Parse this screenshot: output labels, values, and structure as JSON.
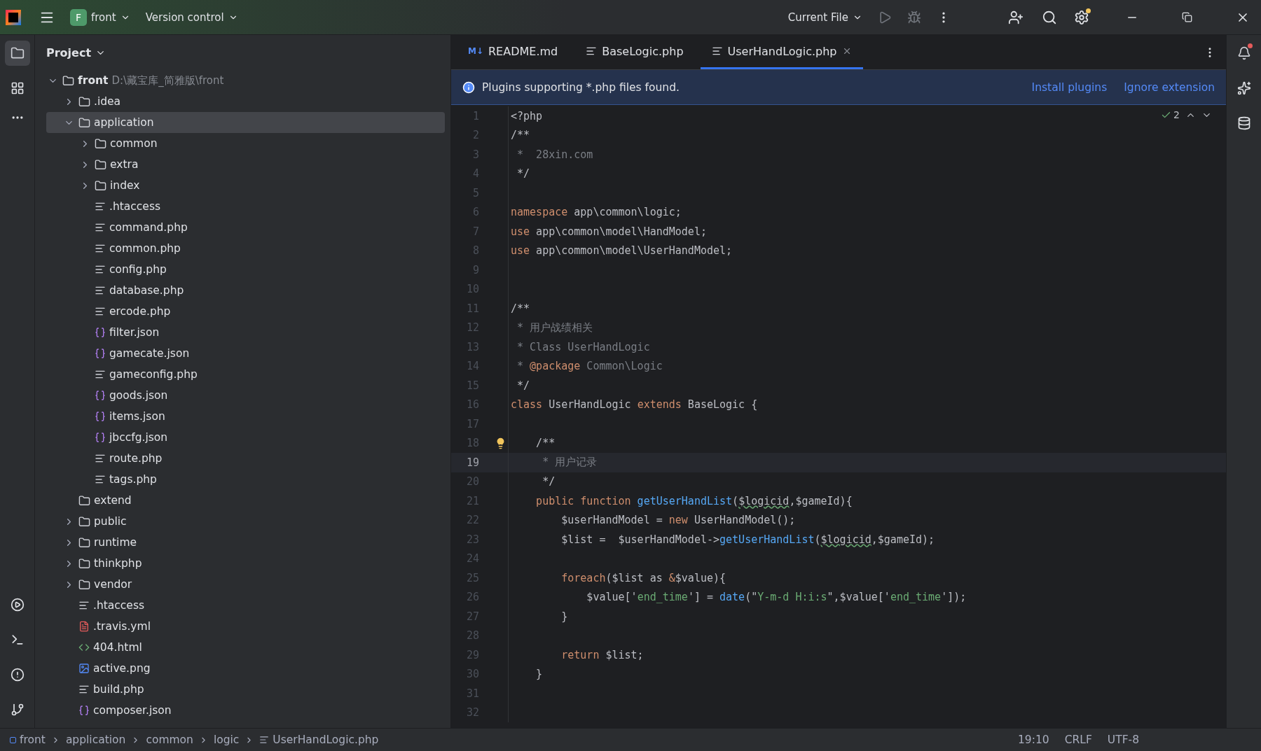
{
  "titlebar": {
    "project_badge": "F",
    "project": "front",
    "vcs": "Version control",
    "run_config": "Current File"
  },
  "project_panel": {
    "title": "Project",
    "tree": [
      {
        "name": "front",
        "path": "D:\\藏宝库_简雅版\\front",
        "kind": "root",
        "expanded": true,
        "selected": false,
        "children": [
          {
            "name": ".idea",
            "kind": "folder",
            "expanded": false,
            "selected": false
          },
          {
            "name": "application",
            "kind": "folder",
            "expanded": true,
            "selected": true,
            "children": [
              {
                "name": "common",
                "kind": "folder",
                "expanded": false,
                "selected": false
              },
              {
                "name": "extra",
                "kind": "folder",
                "expanded": false,
                "selected": false
              },
              {
                "name": "index",
                "kind": "folder",
                "expanded": false,
                "selected": false
              },
              {
                "name": ".htaccess",
                "kind": "text",
                "selected": false
              },
              {
                "name": "command.php",
                "kind": "text",
                "selected": false
              },
              {
                "name": "common.php",
                "kind": "text",
                "selected": false
              },
              {
                "name": "config.php",
                "kind": "text",
                "selected": false
              },
              {
                "name": "database.php",
                "kind": "text",
                "selected": false
              },
              {
                "name": "ercode.php",
                "kind": "text",
                "selected": false
              },
              {
                "name": "filter.json",
                "kind": "json",
                "selected": false
              },
              {
                "name": "gamecate.json",
                "kind": "json",
                "selected": false
              },
              {
                "name": "gameconfig.php",
                "kind": "text",
                "selected": false
              },
              {
                "name": "goods.json",
                "kind": "json",
                "selected": false
              },
              {
                "name": "items.json",
                "kind": "json",
                "selected": false
              },
              {
                "name": "jbccfg.json",
                "kind": "json",
                "selected": false
              },
              {
                "name": "route.php",
                "kind": "text",
                "selected": false
              },
              {
                "name": "tags.php",
                "kind": "text",
                "selected": false
              }
            ]
          },
          {
            "name": "extend",
            "kind": "folder",
            "selected": false
          },
          {
            "name": "public",
            "kind": "folder",
            "expanded": false,
            "selected": false
          },
          {
            "name": "runtime",
            "kind": "folder",
            "expanded": false,
            "selected": false
          },
          {
            "name": "thinkphp",
            "kind": "folder",
            "expanded": false,
            "selected": false
          },
          {
            "name": "vendor",
            "kind": "folder",
            "expanded": false,
            "selected": false
          },
          {
            "name": ".htaccess",
            "kind": "text",
            "selected": false
          },
          {
            "name": ".travis.yml",
            "kind": "yaml",
            "selected": false
          },
          {
            "name": "404.html",
            "kind": "html",
            "selected": false
          },
          {
            "name": "active.png",
            "kind": "image",
            "selected": false
          },
          {
            "name": "build.php",
            "kind": "text",
            "selected": false
          },
          {
            "name": "composer.json",
            "kind": "json",
            "selected": false
          }
        ]
      }
    ]
  },
  "editor": {
    "tabs": [
      {
        "label": "README.md",
        "kind": "markdown",
        "badge": "M↓",
        "selected": false
      },
      {
        "label": "BaseLogic.php",
        "kind": "text",
        "selected": false
      },
      {
        "label": "UserHandLogic.php",
        "kind": "text",
        "selected": true
      }
    ],
    "banner": {
      "message": "Plugins supporting *.php files found.",
      "actions": [
        "Install plugins",
        "Ignore extension"
      ]
    },
    "inspections": "2",
    "lines": [
      {
        "number": "1",
        "current": false,
        "bulb": false,
        "tokens": [
          {
            "kind": "plain",
            "text": "<?php"
          }
        ]
      },
      {
        "number": "2",
        "current": false,
        "bulb": false,
        "tokens": [
          {
            "kind": "plain",
            "text": "/**"
          }
        ]
      },
      {
        "number": "3",
        "current": false,
        "bulb": false,
        "tokens": [
          {
            "kind": "comment",
            "text": " *  28xin.com"
          }
        ]
      },
      {
        "number": "4",
        "current": false,
        "bulb": false,
        "tokens": [
          {
            "kind": "plain",
            "text": " */"
          }
        ]
      },
      {
        "number": "5",
        "current": false,
        "bulb": false
      },
      {
        "number": "6",
        "current": false,
        "bulb": false,
        "tokens": [
          {
            "kind": "keyword",
            "text": "namespace"
          },
          {
            "kind": "plain",
            "text": " app\\common\\logic;"
          }
        ]
      },
      {
        "number": "7",
        "current": false,
        "bulb": false,
        "tokens": [
          {
            "kind": "keyword",
            "text": "use"
          },
          {
            "kind": "plain",
            "text": " app\\common\\model\\HandModel;"
          }
        ]
      },
      {
        "number": "8",
        "current": false,
        "bulb": false,
        "tokens": [
          {
            "kind": "keyword",
            "text": "use"
          },
          {
            "kind": "plain",
            "text": " app\\common\\model\\UserHandModel;"
          }
        ]
      },
      {
        "number": "9",
        "current": false,
        "bulb": false
      },
      {
        "number": "10",
        "current": false,
        "bulb": false
      },
      {
        "number": "11",
        "current": false,
        "bulb": false,
        "tokens": [
          {
            "kind": "plain",
            "text": "/**"
          }
        ]
      },
      {
        "number": "12",
        "current": false,
        "bulb": false,
        "tokens": [
          {
            "kind": "comment",
            "text": " * 用户战绩相关"
          }
        ]
      },
      {
        "number": "13",
        "current": false,
        "bulb": false,
        "tokens": [
          {
            "kind": "comment",
            "text": " * Class UserHandLogic"
          }
        ]
      },
      {
        "number": "14",
        "current": false,
        "bulb": false,
        "tokens": [
          {
            "kind": "comment",
            "text": " *"
          },
          {
            "kind": "doctag",
            "text": " @package"
          },
          {
            "kind": "comment",
            "text": " Common\\Logic"
          }
        ]
      },
      {
        "number": "15",
        "current": false,
        "bulb": false,
        "tokens": [
          {
            "kind": "plain",
            "text": " */"
          }
        ]
      },
      {
        "number": "16",
        "current": false,
        "bulb": false,
        "tokens": [
          {
            "kind": "keyword",
            "text": "class"
          },
          {
            "kind": "plain",
            "text": " UserHandLogic "
          },
          {
            "kind": "keyword",
            "text": "extends"
          },
          {
            "kind": "plain",
            "text": " BaseLogic {"
          }
        ]
      },
      {
        "number": "17",
        "current": false,
        "bulb": false
      },
      {
        "number": "18",
        "current": false,
        "bulb": true,
        "tokens": [
          {
            "kind": "plain",
            "text": "    /**"
          }
        ]
      },
      {
        "number": "19",
        "current": true,
        "bulb": false,
        "tokens": [
          {
            "kind": "comment",
            "text": "     * 用户记录"
          }
        ]
      },
      {
        "number": "20",
        "current": false,
        "bulb": false,
        "tokens": [
          {
            "kind": "plain",
            "text": "     */"
          }
        ]
      },
      {
        "number": "21",
        "current": false,
        "bulb": false,
        "tokens": [
          {
            "kind": "keyword",
            "text": "    public function"
          },
          {
            "kind": "func",
            "text": " getUserHandList"
          },
          {
            "kind": "plain",
            "text": "("
          },
          {
            "kind": "warn",
            "text": "$logicid"
          },
          {
            "kind": "plain",
            "text": ",$gameId){"
          }
        ]
      },
      {
        "number": "22",
        "current": false,
        "bulb": false,
        "tokens": [
          {
            "kind": "plain",
            "text": "        $userHandModel = "
          },
          {
            "kind": "keyword",
            "text": "new"
          },
          {
            "kind": "plain",
            "text": " UserHandModel();"
          }
        ]
      },
      {
        "number": "23",
        "current": false,
        "bulb": false,
        "tokens": [
          {
            "kind": "plain",
            "text": "        $list =  $userHandModel->"
          },
          {
            "kind": "func",
            "text": "getUserHandList"
          },
          {
            "kind": "plain",
            "text": "("
          },
          {
            "kind": "warn",
            "text": "$logicid"
          },
          {
            "kind": "plain",
            "text": ",$gameId);"
          }
        ]
      },
      {
        "number": "24",
        "current": false,
        "bulb": false
      },
      {
        "number": "25",
        "current": false,
        "bulb": false,
        "tokens": [
          {
            "kind": "keyword",
            "text": "        foreach"
          },
          {
            "kind": "plain",
            "text": "($list as "
          },
          {
            "kind": "keyword",
            "text": "&"
          },
          {
            "kind": "plain",
            "text": "$value){"
          }
        ]
      },
      {
        "number": "26",
        "current": false,
        "bulb": false,
        "tokens": [
          {
            "kind": "plain",
            "text": "            $value['"
          },
          {
            "kind": "string",
            "text": "end_time"
          },
          {
            "kind": "plain",
            "text": "'] = "
          },
          {
            "kind": "func",
            "text": "date"
          },
          {
            "kind": "plain",
            "text": "(\""
          },
          {
            "kind": "string",
            "text": "Y-m-d H:i:s"
          },
          {
            "kind": "plain",
            "text": "\",$value['"
          },
          {
            "kind": "string",
            "text": "end_time"
          },
          {
            "kind": "plain",
            "text": "']);"
          }
        ]
      },
      {
        "number": "27",
        "current": false,
        "bulb": false,
        "tokens": [
          {
            "kind": "plain",
            "text": "        }"
          }
        ]
      },
      {
        "number": "28",
        "current": false,
        "bulb": false
      },
      {
        "number": "29",
        "current": false,
        "bulb": false,
        "tokens": [
          {
            "kind": "keyword",
            "text": "        return"
          },
          {
            "kind": "plain",
            "text": " $list;"
          }
        ]
      },
      {
        "number": "30",
        "current": false,
        "bulb": false,
        "tokens": [
          {
            "kind": "plain",
            "text": "    }"
          }
        ]
      },
      {
        "number": "31",
        "current": false,
        "bulb": false
      },
      {
        "number": "32",
        "current": false,
        "bulb": false
      }
    ]
  },
  "status_bar": {
    "breadcrumbs": [
      "front",
      "application",
      "common",
      "logic",
      "UserHandLogic.php"
    ],
    "position": "19:10",
    "line_ending": "CRLF",
    "encoding": "UTF-8"
  }
}
